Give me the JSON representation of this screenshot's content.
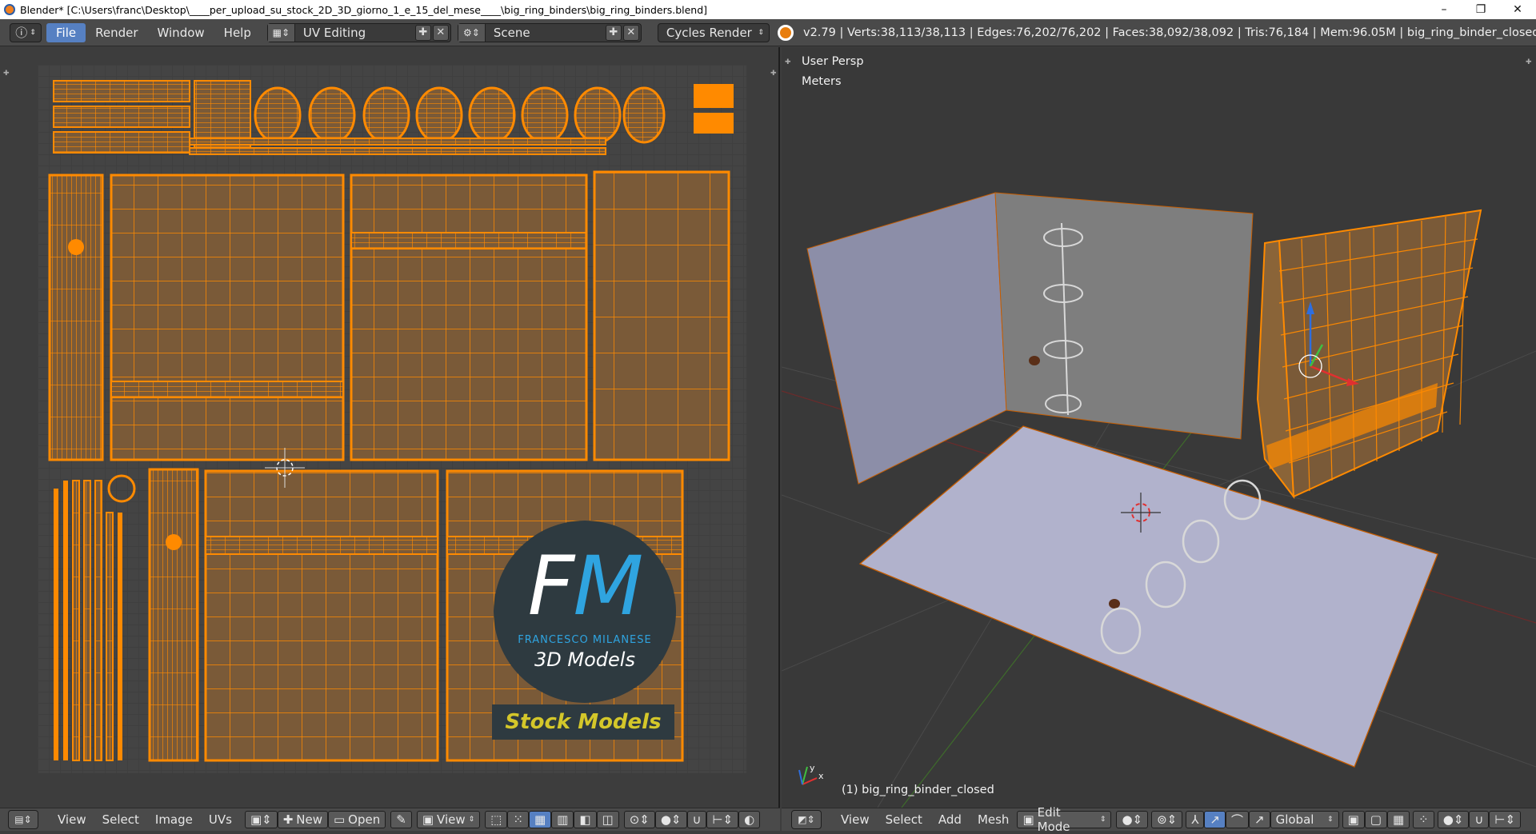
{
  "window": {
    "title": "Blender* [C:\\Users\\franc\\Desktop\\____per_upload_su_stock_2D_3D_giorno_1_e_15_del_mese____\\big_ring_binders\\big_ring_binders.blend]",
    "controls": [
      "–",
      "❐",
      "✕"
    ]
  },
  "infobar": {
    "menus": [
      "File",
      "Render",
      "Window",
      "Help"
    ],
    "screen_layout": "UV Editing",
    "scene": "Scene",
    "render_engine": "Cycles Render",
    "stats": "v2.79 | Verts:38,113/38,113 | Edges:76,202/76,202 | Faces:38,092/38,092 | Tris:76,184 | Mem:96.05M | big_ring_binder_closed"
  },
  "uv_editor": {
    "footer": {
      "menus": [
        "View",
        "Select",
        "Image",
        "UVs"
      ],
      "new_label": "New",
      "open_label": "Open",
      "view_label": "View"
    },
    "watermark": {
      "logo_f": "F",
      "logo_m": "M",
      "author": "FRANCESCO MILANESE",
      "subtitle": "3D Models",
      "tag": "Stock Models"
    }
  },
  "viewport": {
    "view_label": "User Persp",
    "units_label": "Meters",
    "object_label": "(1) big_ring_binder_closed",
    "axis_x": "x",
    "axis_y": "y",
    "footer": {
      "menus": [
        "View",
        "Select",
        "Add",
        "Mesh"
      ],
      "mode": "Edit Mode",
      "orientation": "Global"
    }
  },
  "colors": {
    "uv_orange": "#ff8a00",
    "uv_fill": "#7a5a38",
    "accent_blue": "#5680c2",
    "binder_face": "#a8a9c6"
  }
}
